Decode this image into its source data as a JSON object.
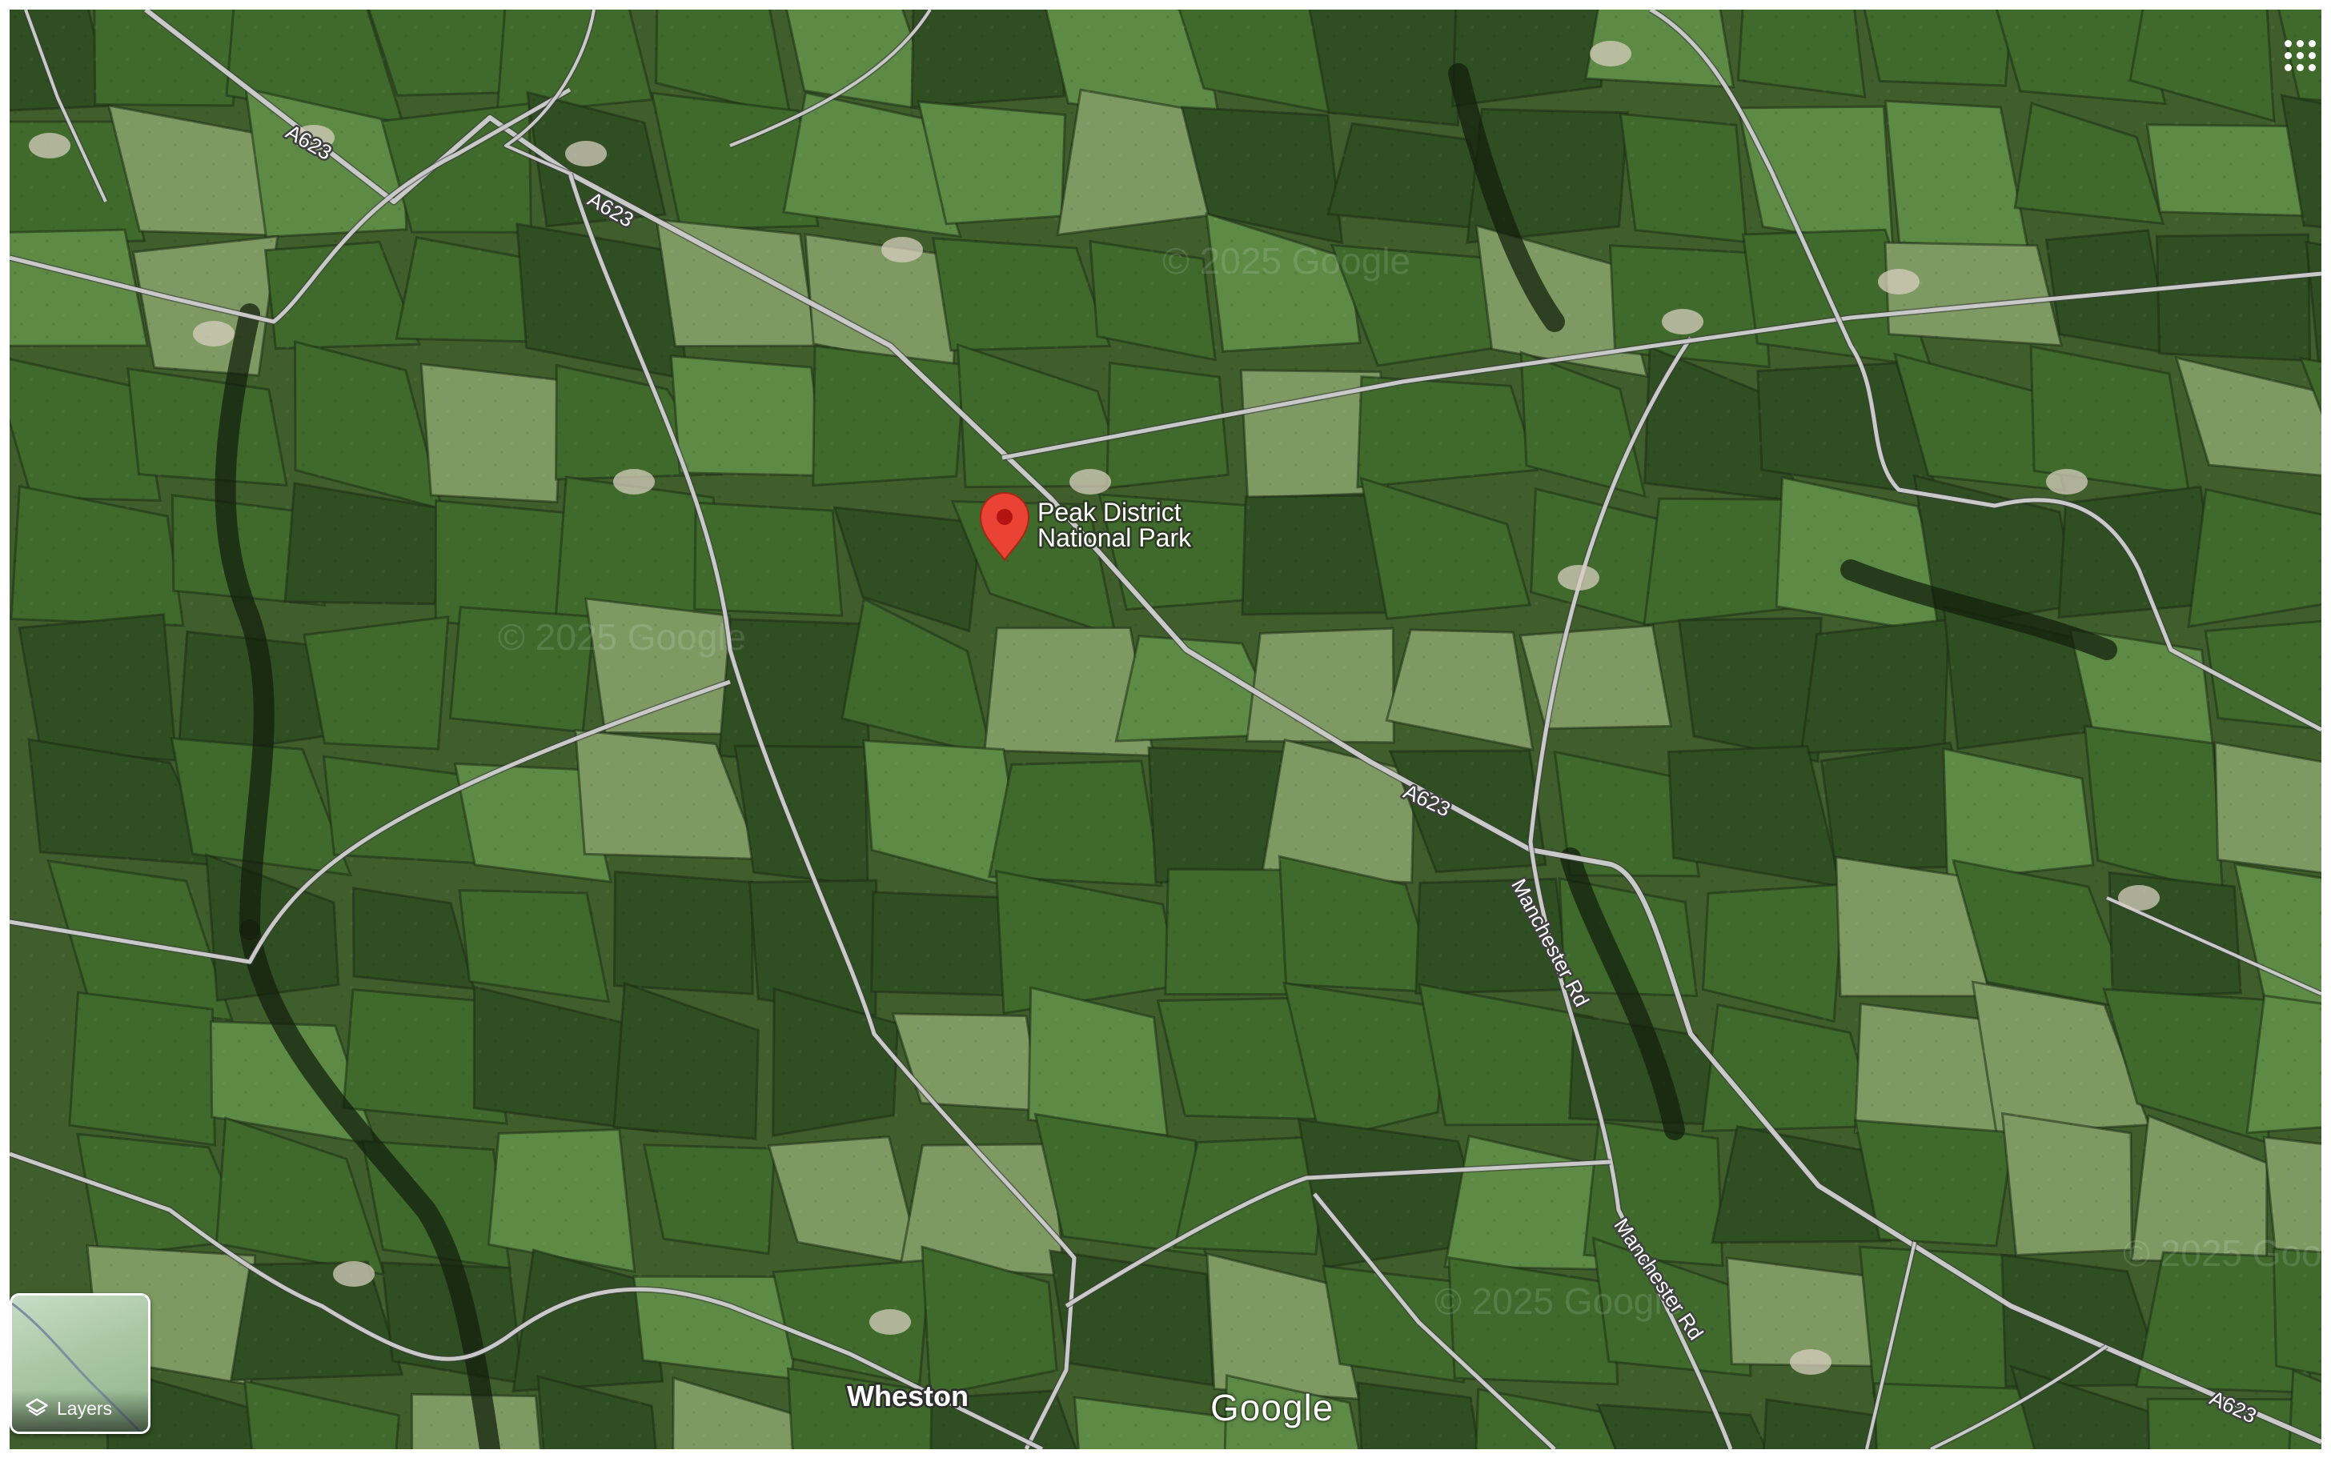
{
  "map": {
    "type": "satellite",
    "colors": {
      "field_dark": "#2f4e22",
      "field_mid": "#3f6a2c",
      "field_light": "#5d8a45",
      "field_pale": "#7e9a62",
      "road": "#c9c9c9",
      "pin": "#ea4335",
      "pin_dot": "#b31412"
    },
    "roads": [
      {
        "label": "A623",
        "kind": "main-road"
      },
      {
        "label": "Manchester Rd",
        "kind": "minor-road"
      }
    ],
    "road_labels": {
      "a623_1": "A623",
      "a623_2": "A623",
      "a623_3": "A623",
      "a623_4": "A623",
      "manchester_1": "Manchester Rd",
      "manchester_2": "Manchester Rd"
    },
    "poi": {
      "name_line1": "Peak District",
      "name_line2": "National Park",
      "icon": "map-pin-icon"
    },
    "village": "Wheston",
    "watermark": "© 2025 Google"
  },
  "controls": {
    "apps_icon": "apps-grid-icon",
    "layers_label": "Layers",
    "layers_icon": "layers-icon"
  },
  "branding": {
    "logo": "Google"
  }
}
